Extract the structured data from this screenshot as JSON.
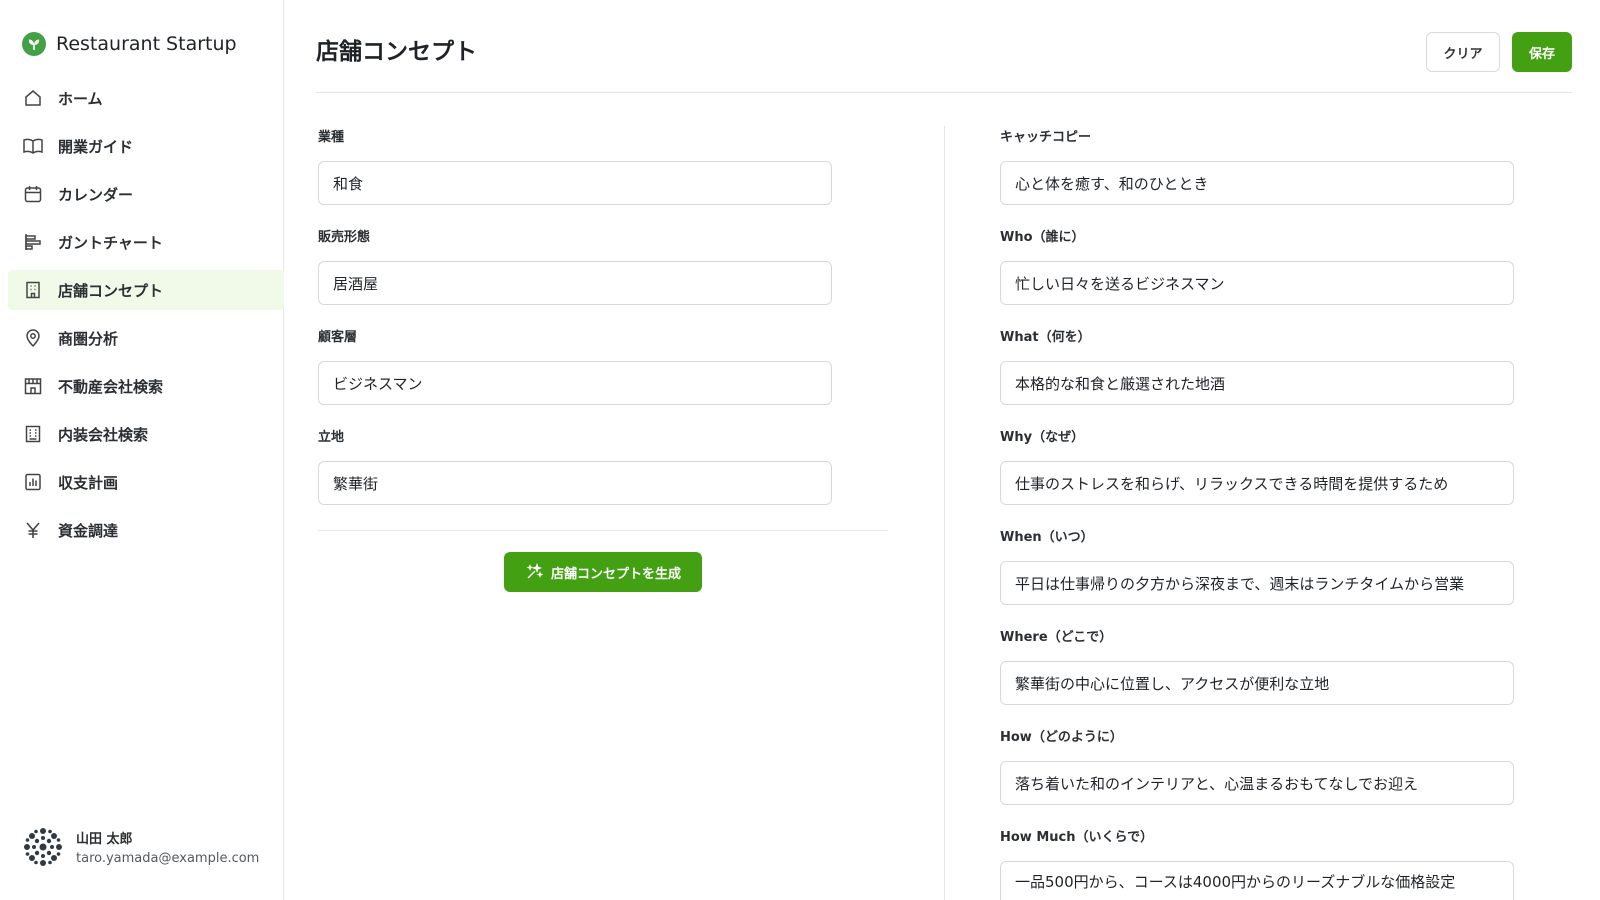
{
  "app": {
    "name": "Restaurant Startup"
  },
  "sidebar": {
    "items": [
      {
        "label": "ホーム",
        "icon": "home-icon"
      },
      {
        "label": "開業ガイド",
        "icon": "book-icon"
      },
      {
        "label": "カレンダー",
        "icon": "calendar-icon"
      },
      {
        "label": "ガントチャート",
        "icon": "gantt-icon"
      },
      {
        "label": "店舗コンセプト",
        "icon": "building-icon",
        "active": true
      },
      {
        "label": "商圏分析",
        "icon": "map-pin-icon"
      },
      {
        "label": "不動産会社検索",
        "icon": "storefront-icon"
      },
      {
        "label": "内装会社検索",
        "icon": "office-building-icon"
      },
      {
        "label": "収支計画",
        "icon": "bar-chart-icon"
      },
      {
        "label": "資金調達",
        "icon": "yen-icon"
      }
    ]
  },
  "user": {
    "name": "山田 太郎",
    "email": "taro.yamada@example.com"
  },
  "header": {
    "title": "店舗コンセプト",
    "clear_label": "クリア",
    "save_label": "保存"
  },
  "left_form": {
    "fields": [
      {
        "label": "業種",
        "value": "和食"
      },
      {
        "label": "販売形態",
        "value": "居酒屋"
      },
      {
        "label": "顧客層",
        "value": "ビジネスマン"
      },
      {
        "label": "立地",
        "value": "繁華街"
      }
    ],
    "generate_label": "店舗コンセプトを生成"
  },
  "right_form": {
    "fields": [
      {
        "label": "キャッチコピー",
        "value": "心と体を癒す、和のひととき"
      },
      {
        "label": "Who（誰に）",
        "value": "忙しい日々を送るビジネスマン"
      },
      {
        "label": "What（何を）",
        "value": "本格的な和食と厳選された地酒"
      },
      {
        "label": "Why（なぜ）",
        "value": "仕事のストレスを和らげ、リラックスできる時間を提供するため"
      },
      {
        "label": "When（いつ）",
        "value": "平日は仕事帰りの夕方から深夜まで、週末はランチタイムから営業"
      },
      {
        "label": "Where（どこで）",
        "value": "繁華街の中心に位置し、アクセスが便利な立地"
      },
      {
        "label": "How（どのように）",
        "value": "落ち着いた和のインテリアと、心温まるおもてなしでお迎え"
      },
      {
        "label": "How Much（いくらで）",
        "value": "一品500円から、コースは4000円からのリーズナブルな価格設定"
      }
    ]
  },
  "colors": {
    "accent": "#43a013",
    "active_bg": "#f1fae8"
  }
}
